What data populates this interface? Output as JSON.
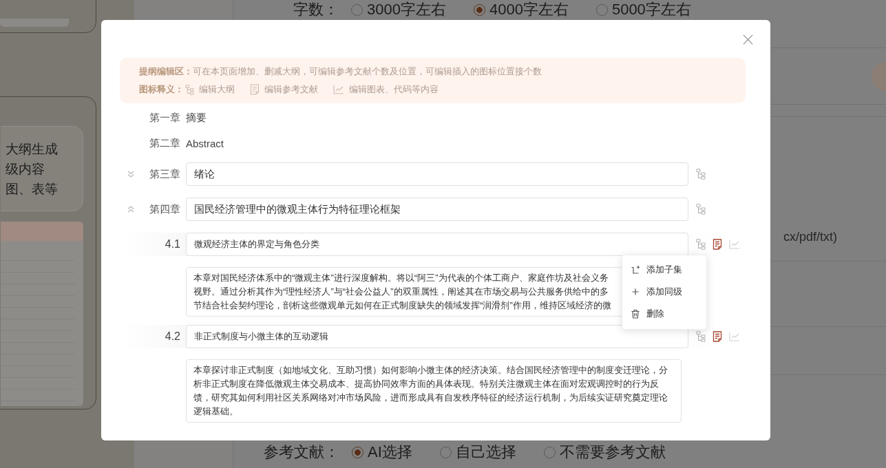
{
  "background": {
    "word_count": {
      "label": "字数：",
      "options": [
        {
          "label": "3000字左右",
          "selected": false
        },
        {
          "label": "4000字左右",
          "selected": true
        },
        {
          "label": "5000字左右",
          "selected": false
        }
      ]
    },
    "sidebar_card": {
      "lines": [
        "大纲生成",
        "级内容",
        "图、表等"
      ]
    },
    "format_hint": "cx/pdf/txt)",
    "references": {
      "label": "参考文献：",
      "options": [
        {
          "label": "AI选择",
          "selected": true
        },
        {
          "label": "自己选择",
          "selected": false
        },
        {
          "label": "不需要参考文献",
          "selected": false
        }
      ]
    }
  },
  "dialog": {
    "notice": {
      "title": "提纲编辑区：",
      "text": "可在本页面增加、删减大纲，可编辑参考文献个数及位置，可编辑插入的图标位置接个数",
      "legend_label": "图标释义：",
      "legend": [
        {
          "kind": "outline",
          "label": "编辑大纲"
        },
        {
          "kind": "references",
          "label": "编辑参考文献"
        },
        {
          "kind": "chart",
          "label": "编辑图表、代码等内容"
        }
      ]
    },
    "chapters": [
      {
        "kind": "fixed",
        "number": "第一章",
        "title": "摘要"
      },
      {
        "kind": "fixed",
        "number": "第二章",
        "title": "Abstract"
      },
      {
        "kind": "editable",
        "number": "第三章",
        "title": "绪论",
        "expanded": false,
        "actions": [
          {
            "kind": "outline",
            "on": false
          }
        ]
      },
      {
        "kind": "editable",
        "number": "第四章",
        "title": "国民经济管理中的微观主体行为特征理论框架",
        "expanded": true,
        "actions": [
          {
            "kind": "outline",
            "on": false
          }
        ],
        "children": [
          {
            "number": "4.1",
            "title": "微观经济主体的界定与角色分类",
            "actions": [
              {
                "kind": "outline",
                "on": false
              },
              {
                "kind": "references",
                "on": true
              },
              {
                "kind": "chart",
                "on": false
              }
            ],
            "description_lines": [
              "本章对国民经济体系中的“微观主体”进行深度解构。将以“阿三”为代表的个体工商户、家庭作坊及社会义务",
              "视野。通过分析其作为“理性经济人”与“社会公益人”的双重属性，阐述其在市场交易与公共服务供给中的多",
              "节结合社会契约理论，剖析这些微观单元如何在正式制度缺失的领域发挥“润滑剂”作用，维持区域经济的微"
            ]
          },
          {
            "number": "4.2",
            "title": "非正式制度与小微主体的互动逻辑",
            "actions": [
              {
                "kind": "outline",
                "on": false
              },
              {
                "kind": "references",
                "on": true
              },
              {
                "kind": "chart",
                "on": false
              }
            ],
            "description_lines": [
              "本章探讨非正式制度（如地域文化、互助习惯）如何影响小微主体的经济决策。结合国民经济管理中的制度变迁理论，分",
              "析非正式制度在降低微观主体交易成本、提高协同效率方面的具体表现。特别关注微观主体在面对宏观调控时的行为反",
              "馈，研究其如何利用社区关系网络对冲市场风险，进而形成具有自发秩序特征的经济运行机制，为后续实证研究奠定理论",
              "逻辑基础。"
            ]
          }
        ]
      }
    ],
    "context_menu": {
      "items": [
        {
          "kind": "add-child",
          "label": "添加子集"
        },
        {
          "kind": "add-sibling",
          "label": "添加同级"
        },
        {
          "kind": "delete",
          "label": "删除"
        }
      ]
    }
  }
}
